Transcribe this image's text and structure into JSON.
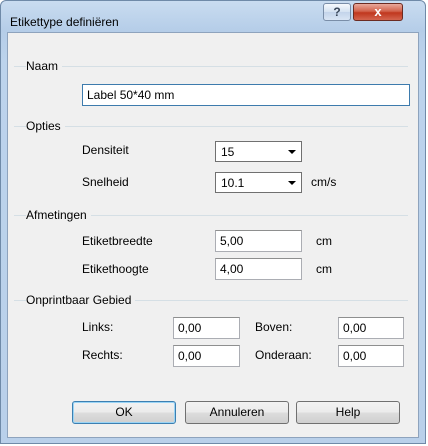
{
  "window": {
    "title": "Etikettype definiëren",
    "help_glyph": "?",
    "close_glyph": "x"
  },
  "naam": {
    "group_label": "Naam",
    "value": "Label 50*40 mm"
  },
  "opties": {
    "group_label": "Opties",
    "densiteit_label": "Densiteit",
    "densiteit_value": "15",
    "snelheid_label": "Snelheid",
    "snelheid_value": "10.1",
    "snelheid_unit": "cm/s"
  },
  "afmetingen": {
    "group_label": "Afmetingen",
    "breedte_label": "Etiketbreedte",
    "breedte_value": "5,00",
    "breedte_unit": "cm",
    "hoogte_label": "Etikethoogte",
    "hoogte_value": "4,00",
    "hoogte_unit": "cm"
  },
  "onprintbaar": {
    "group_label": "Onprintbaar Gebied",
    "links_label": "Links:",
    "links_value": "0,00",
    "boven_label": "Boven:",
    "boven_value": "0,00",
    "rechts_label": "Rechts:",
    "rechts_value": "0,00",
    "onderaan_label": "Onderaan:",
    "onderaan_value": "0,00"
  },
  "buttons": {
    "ok": "OK",
    "cancel": "Annuleren",
    "help": "Help"
  }
}
